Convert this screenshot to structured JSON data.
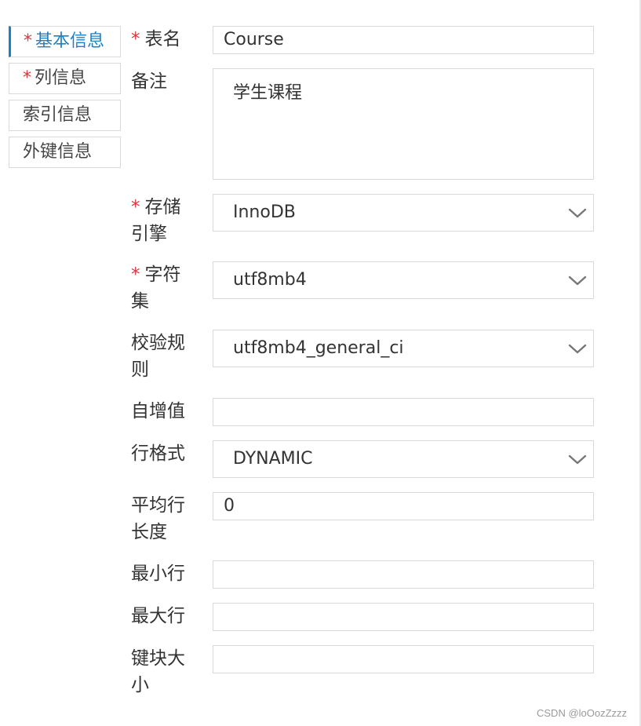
{
  "tabs": [
    {
      "label": "基本信息",
      "required": "*"
    },
    {
      "label": "列信息",
      "required": "*"
    },
    {
      "label": "索引信息"
    },
    {
      "label": "外键信息"
    }
  ],
  "form": {
    "required_mark": "*",
    "table_name": {
      "label": "表名",
      "value": "Course"
    },
    "comment": {
      "label": "备注",
      "value": "学生课程"
    },
    "engine": {
      "label_line1": "存储",
      "label_line2": "引擎",
      "value": "InnoDB"
    },
    "charset": {
      "label_line1": "字符",
      "label_line2": "集",
      "value": "utf8mb4"
    },
    "collation": {
      "label_line1": "校验规",
      "label_line2": "则",
      "value": "utf8mb4_general_ci"
    },
    "auto_increment": {
      "label": "自增值",
      "value": ""
    },
    "row_format": {
      "label": "行格式",
      "value": "DYNAMIC"
    },
    "avg_row_length": {
      "label_line1": "平均行",
      "label_line2": "长度",
      "value": "0"
    },
    "min_rows": {
      "label": "最小行",
      "value": ""
    },
    "max_rows": {
      "label": "最大行",
      "value": ""
    },
    "key_block_size": {
      "label_line1": "键块大",
      "label_line2": "小",
      "value": ""
    }
  },
  "watermark": "CSDN @loOozZzzz",
  "colors": {
    "accent": "#1f7fc3",
    "required": "#d9363e",
    "border": "#d9d9d9"
  }
}
